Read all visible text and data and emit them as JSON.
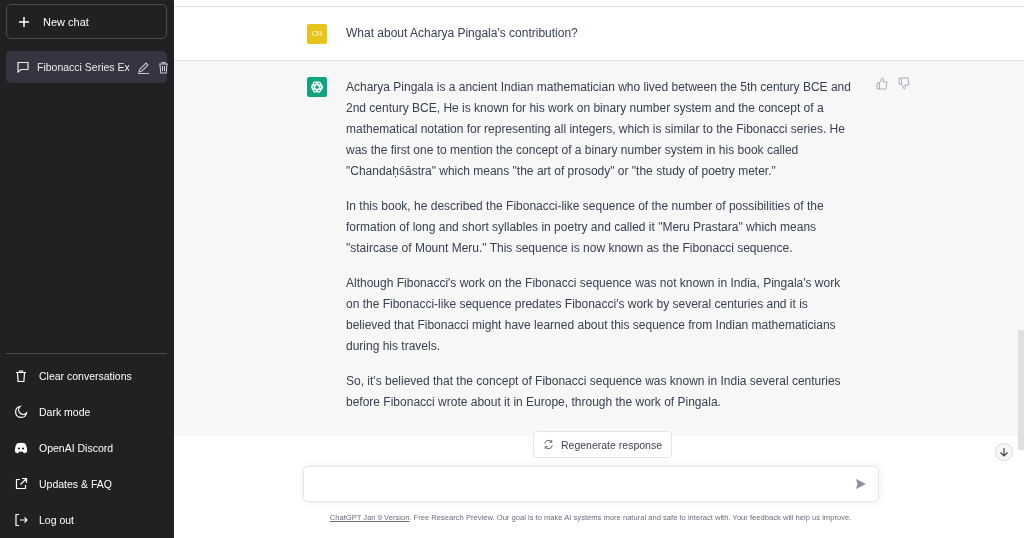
{
  "sidebar": {
    "new_chat": "New chat",
    "conversations": [
      {
        "title": "Fibonacci Series Ex",
        "selected": true
      }
    ],
    "menu": [
      {
        "kind": "trash",
        "label": "Clear conversations"
      },
      {
        "kind": "moon",
        "label": "Dark mode"
      },
      {
        "kind": "discord",
        "label": "OpenAI Discord"
      },
      {
        "kind": "external",
        "label": "Updates & FAQ"
      },
      {
        "kind": "logout",
        "label": "Log out"
      }
    ]
  },
  "messages": [
    {
      "kind": "user",
      "avatar": "CH",
      "paragraphs": [
        "What about Acharya Pingala's contribution?"
      ]
    },
    {
      "kind": "assistant",
      "paragraphs": [
        "Acharya Pingala is a ancient Indian mathematician who lived between the 5th century BCE and 2nd century BCE, He is known for his work on binary number system and the concept of a mathematical notation for representing all integers, which is similar to the Fibonacci series. He was the first one to mention the concept of a binary number system in his book called \"Chandaḥśāstra\" which means \"the art of prosody\" or \"the study of poetry meter.\"",
        "In this book, he described the Fibonacci-like sequence of the number of possibilities of the formation of long and short syllables in poetry and called it \"Meru Prastara\" which means \"staircase of Mount Meru.\" This sequence is now known as the Fibonacci sequence.",
        "Although Fibonacci's work on the Fibonacci sequence was not known in India, Pingala's work on the Fibonacci-like sequence predates Fibonacci's work by several centuries and it is believed that Fibonacci might have learned about this sequence from Indian mathematicians during his travels.",
        "So, it's believed that the concept of Fibonacci sequence was known in India several centuries before Fibonacci wrote about it in Europe, through the work of Pingala."
      ]
    }
  ],
  "regenerate": "Regenerate response",
  "footer": {
    "link": "ChatGPT Jan 9 Version",
    "text": ". Free Research Preview. Our goal is to make AI systems more natural and safe to interact with. Your feedback will help us improve."
  }
}
